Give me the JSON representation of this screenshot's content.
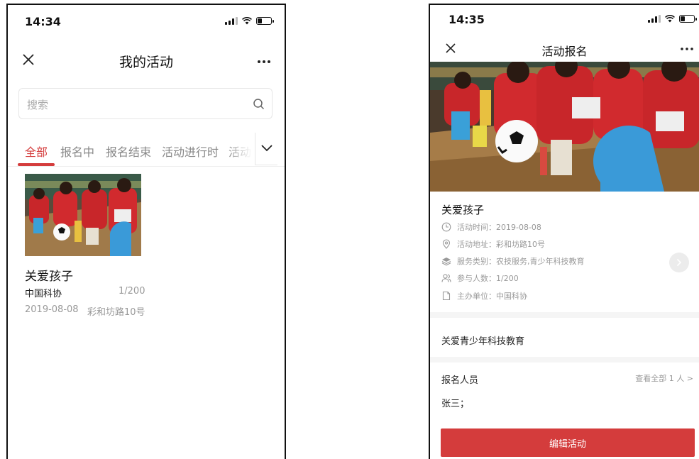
{
  "colors": {
    "accent": "#d43c3c",
    "muted": "#999999",
    "text": "#222222"
  },
  "screen1": {
    "status": {
      "time": "14:34"
    },
    "nav": {
      "title": "我的活动",
      "close_icon": "close-icon",
      "more_icon": "more-dots-icon"
    },
    "search": {
      "placeholder": "搜索",
      "icon": "search-icon"
    },
    "tabs": [
      {
        "label": "全部",
        "active": true
      },
      {
        "label": "报名中",
        "active": false
      },
      {
        "label": "报名结束",
        "active": false
      },
      {
        "label": "活动进行时",
        "active": false
      },
      {
        "label": "活动",
        "active": false
      }
    ],
    "card": {
      "title": "关爱孩子",
      "org": "中国科协",
      "count": "1/200",
      "date": "2019-08-08",
      "address": "彩和坊路10号"
    }
  },
  "screen2": {
    "status": {
      "time": "14:35"
    },
    "nav": {
      "title": "活动报名"
    },
    "activity": {
      "title": "关爱孩子",
      "time_label": "活动时间：",
      "time_value": "2019-08-08",
      "address_label": "活动地址：",
      "address_value": "彩和坊路10号",
      "category_label": "服务类别：",
      "category_value": "农技服务,青少年科技教育",
      "people_label": "参与人数：",
      "people_value": "1/200",
      "host_label": "主办单位：",
      "host_value": "中国科协"
    },
    "description": "关爱青少年科技教育",
    "signup": {
      "title": "报名人员",
      "view_all": "查看全部 1 人 >",
      "names": "张三；"
    },
    "edit_button": "编辑活动"
  }
}
